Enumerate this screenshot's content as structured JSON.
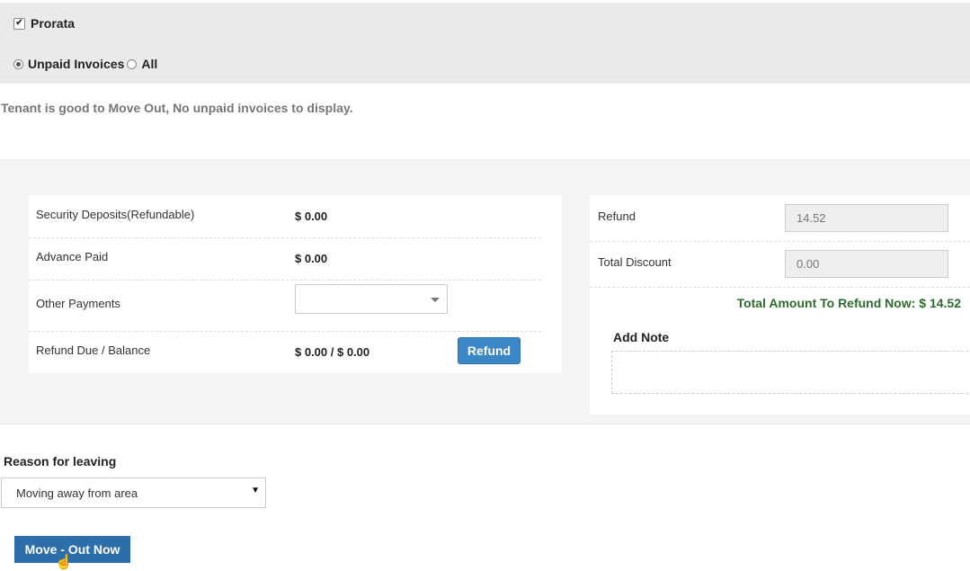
{
  "filters": {
    "prorata_label": "Prorata",
    "prorata_checked": true,
    "unpaid_label": "Unpaid Invoices",
    "all_label": "All",
    "selected_scope": "Unpaid Invoices"
  },
  "status_message": "Tenant is good to Move Out, No unpaid invoices to display.",
  "deposits": {
    "security_label": "Security Deposits(Refundable)",
    "security_value": "$ 0.00",
    "advance_label": "Advance Paid",
    "advance_value": "$ 0.00",
    "other_label": "Other Payments",
    "other_value": "",
    "refund_due_label": "Refund Due / Balance",
    "refund_due_value": "$ 0.00 / $ 0.00",
    "refund_button": "Refund"
  },
  "refund_summary": {
    "refund_label": "Refund",
    "refund_value": "14.52",
    "discount_label": "Total Discount",
    "discount_value": "0.00",
    "total_text": "Total Amount To Refund Now: $ 14.52",
    "note_label": "Add Note",
    "note_value": ""
  },
  "reason": {
    "label": "Reason for leaving",
    "selected": "Moving away from area"
  },
  "actions": {
    "move_out_button": "Move - Out Now"
  },
  "colors": {
    "primary_button": "#3a86c8",
    "move_out_button": "#2c6eaa",
    "total_text": "#2e6b2e"
  },
  "icons": {
    "dropdown": "caret-down-icon",
    "cursor": "hand-pointer-icon"
  }
}
